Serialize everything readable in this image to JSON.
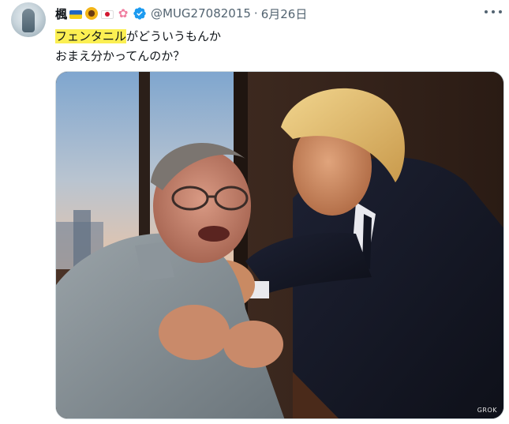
{
  "tweet": {
    "display_name": "楓",
    "emojis": [
      "ukraine-flag",
      "sunflower",
      "japan-flag",
      "cherry-blossom"
    ],
    "handle": "@MUG27082015",
    "separator": "·",
    "date": "6月26日",
    "text_highlight": "フェンタニル",
    "text_line1_rest": "がどういうもんか",
    "text_line2": "おまえ分かってんのか？"
  },
  "media": {
    "watermark": "GROK"
  },
  "colors": {
    "verified": "#1d9bf0",
    "highlight": "#fbef52",
    "secondary_text": "#536471"
  }
}
